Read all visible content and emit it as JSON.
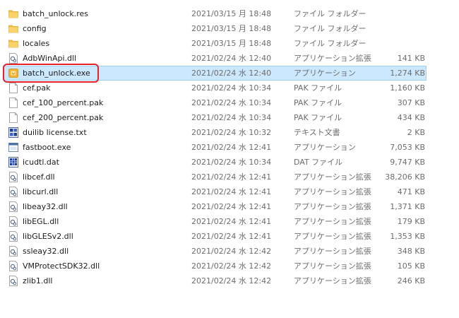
{
  "files": [
    {
      "name": "batch_unlock.res",
      "date": "2021/03/15 月 18:48",
      "type": "ファイル フォルダー",
      "size": "",
      "icon": "folder-icon",
      "selected": false
    },
    {
      "name": "config",
      "date": "2021/03/15 月 18:48",
      "type": "ファイル フォルダー",
      "size": "",
      "icon": "folder-icon",
      "selected": false
    },
    {
      "name": "locales",
      "date": "2021/03/15 月 18:48",
      "type": "ファイル フォルダー",
      "size": "",
      "icon": "folder-icon",
      "selected": false
    },
    {
      "name": "AdbWinApi.dll",
      "date": "2021/02/24 水 12:40",
      "type": "アプリケーション拡張",
      "size": "141 KB",
      "icon": "dll-icon",
      "selected": false
    },
    {
      "name": "batch_unlock.exe",
      "date": "2021/02/24 水 12:40",
      "type": "アプリケーション",
      "size": "1,274 KB",
      "icon": "app-icon",
      "selected": true
    },
    {
      "name": "cef.pak",
      "date": "2021/02/24 水 10:34",
      "type": "PAK ファイル",
      "size": "1,160 KB",
      "icon": "file-icon",
      "selected": false
    },
    {
      "name": "cef_100_percent.pak",
      "date": "2021/02/24 水 10:34",
      "type": "PAK ファイル",
      "size": "307 KB",
      "icon": "file-icon",
      "selected": false
    },
    {
      "name": "cef_200_percent.pak",
      "date": "2021/02/24 水 10:34",
      "type": "PAK ファイル",
      "size": "434 KB",
      "icon": "file-icon",
      "selected": false
    },
    {
      "name": "duilib license.txt",
      "date": "2021/02/24 水 10:32",
      "type": "テキスト文書",
      "size": "2 KB",
      "icon": "text-file-icon",
      "selected": false
    },
    {
      "name": "fastboot.exe",
      "date": "2021/02/24 水 12:41",
      "type": "アプリケーション",
      "size": "7,053 KB",
      "icon": "exe-icon",
      "selected": false
    },
    {
      "name": "icudtl.dat",
      "date": "2021/02/24 水 10:34",
      "type": "DAT ファイル",
      "size": "9,747 KB",
      "icon": "dat-icon",
      "selected": false
    },
    {
      "name": "libcef.dll",
      "date": "2021/02/24 水 12:41",
      "type": "アプリケーション拡張",
      "size": "38,206 KB",
      "icon": "dll-icon",
      "selected": false
    },
    {
      "name": "libcurl.dll",
      "date": "2021/02/24 水 12:41",
      "type": "アプリケーション拡張",
      "size": "471 KB",
      "icon": "dll-icon",
      "selected": false
    },
    {
      "name": "libeay32.dll",
      "date": "2021/02/24 水 12:41",
      "type": "アプリケーション拡張",
      "size": "1,371 KB",
      "icon": "dll-icon",
      "selected": false
    },
    {
      "name": "libEGL.dll",
      "date": "2021/02/24 水 12:41",
      "type": "アプリケーション拡張",
      "size": "179 KB",
      "icon": "dll-icon",
      "selected": false
    },
    {
      "name": "libGLESv2.dll",
      "date": "2021/02/24 水 12:41",
      "type": "アプリケーション拡張",
      "size": "1,353 KB",
      "icon": "dll-icon",
      "selected": false
    },
    {
      "name": "ssleay32.dll",
      "date": "2021/02/24 水 12:42",
      "type": "アプリケーション拡張",
      "size": "348 KB",
      "icon": "dll-icon",
      "selected": false
    },
    {
      "name": "VMProtectSDK32.dll",
      "date": "2021/02/24 水 12:42",
      "type": "アプリケーション拡張",
      "size": "105 KB",
      "icon": "dll-icon",
      "selected": false
    },
    {
      "name": "zlib1.dll",
      "date": "2021/02/24 水 12:42",
      "type": "アプリケーション拡張",
      "size": "246 KB",
      "icon": "dll-icon",
      "selected": false
    }
  ],
  "colors": {
    "selection_bg": "#cce8ff",
    "selection_border": "#99d1ff",
    "highlight_annotation": "#e8212b",
    "folder": "#f3c14b"
  }
}
